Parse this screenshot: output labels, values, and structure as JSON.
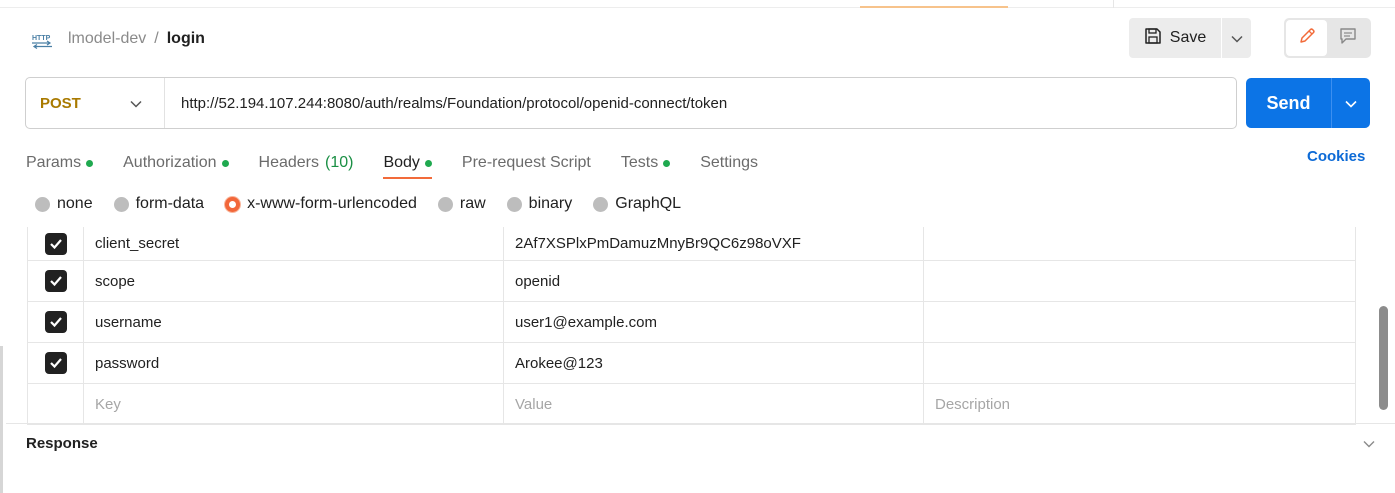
{
  "breadcrumb": {
    "parent": "lmodel-dev",
    "separator": "/",
    "current": "login",
    "icon": "http-icon"
  },
  "toolbar": {
    "save_label": "Save"
  },
  "request": {
    "method": "POST",
    "url": "http://52.194.107.244:8080/auth/realms/Foundation/protocol/openid-connect/token",
    "send_label": "Send"
  },
  "tabs": [
    {
      "label": "Params",
      "dot": true
    },
    {
      "label": "Authorization",
      "dot": true
    },
    {
      "label": "Headers",
      "count": "(10)"
    },
    {
      "label": "Body",
      "dot": true,
      "active": true
    },
    {
      "label": "Pre-request Script"
    },
    {
      "label": "Tests",
      "dot": true
    },
    {
      "label": "Settings"
    }
  ],
  "cookies_label": "Cookies",
  "body_types": [
    "none",
    "form-data",
    "x-www-form-urlencoded",
    "raw",
    "binary",
    "GraphQL"
  ],
  "body_type_selected": "x-www-form-urlencoded",
  "params": [
    {
      "key": "client_secret",
      "value": "2Af7XSPlxPmDamuzMnyBr9QC6z98oVXF",
      "description": "",
      "checked": true
    },
    {
      "key": "scope",
      "value": "openid",
      "description": "",
      "checked": true
    },
    {
      "key": "username",
      "value": "user1@example.com",
      "description": "",
      "checked": true
    },
    {
      "key": "password",
      "value": "Arokee@123",
      "description": "",
      "checked": true
    }
  ],
  "placeholders": {
    "key": "Key",
    "value": "Value",
    "description": "Description"
  },
  "response": {
    "title": "Response"
  },
  "colors": {
    "method": "#a97a00",
    "send": "#0c74e6",
    "active_tab": "#f26b3a",
    "status_dot": "#1fa94f",
    "link": "#0c6ad6"
  }
}
